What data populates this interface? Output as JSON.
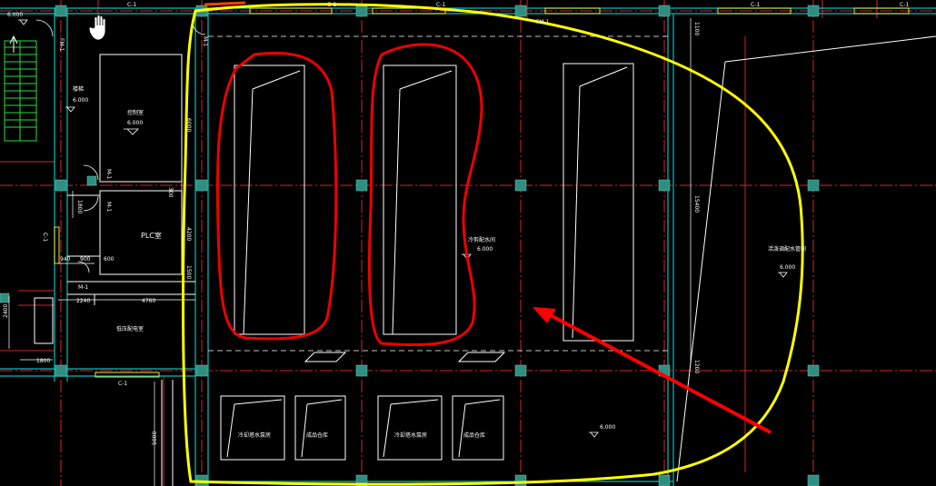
{
  "drawing": {
    "labels": {
      "fm1_top_left": "FM-1",
      "fm1_top_mid": "FM-1",
      "m1_top": "M-1",
      "m1_left_a": "M-1",
      "m1_left_b": "M-1",
      "m1_bottom": "M-1",
      "c1_left": "C-1",
      "c1_bottom": "C-1",
      "c1_top_a": "C-1",
      "c1_top_b": "C-1",
      "c1_top_c": "C-1",
      "c1_top_d": "C-1",
      "c1_top_e": "C-1",
      "plc_room": "PLC室",
      "control_room": "控制室",
      "stair_hall": "楼梯",
      "low_voltage_room": "低压配电室",
      "cold_cut_room": "冷剪配水间",
      "hot_cut_room": "活泼调配水管间",
      "pump_left_1": "冷却塔水泵房",
      "pump_left_2": "成品仓库",
      "pump_right_1": "冷却塔水泵房",
      "pump_right_2": "成品仓库"
    },
    "elevations": {
      "top_left": "6.000",
      "stair": "6.000",
      "control": "6.000",
      "cold_cut": "6.000",
      "hot_cut": "6.000",
      "bottom_mid": "6.000"
    },
    "dimensions": {
      "d6000": "6000",
      "d4200": "4200",
      "d1800": "1800",
      "d300": "300",
      "d940": "940",
      "d900": "900",
      "d600": "600",
      "d2240": "2240",
      "d4760": "4760",
      "d2400": "2400",
      "d1800b": "1800",
      "d5000": "5000",
      "d15400": "15400",
      "d1100": "1100",
      "d1200": "1200",
      "d1500": "1500"
    },
    "colors": {
      "background": "#000000",
      "axis": "#ff3030",
      "grid_dash": "#cc2222",
      "wall": "#00c8c8",
      "column": "#2a9a8a",
      "text": "#ffffff",
      "outline_white": "#ffffff",
      "window": "#e0e040",
      "stair": "#20ff40",
      "annotation_yellow": "#ffff00",
      "annotation_red": "#ff0000"
    },
    "icons": {
      "cursor": "hand-cursor-icon"
    }
  }
}
